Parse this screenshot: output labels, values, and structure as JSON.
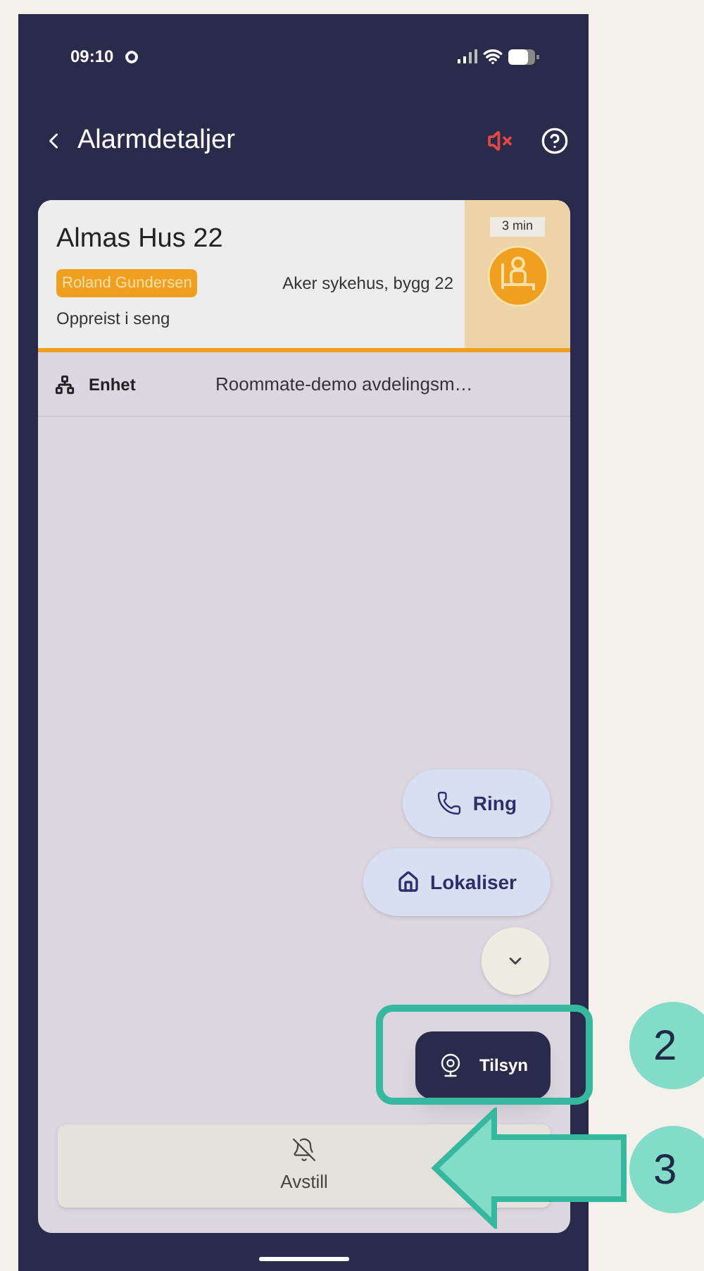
{
  "status_bar": {
    "time": "09:10"
  },
  "header": {
    "title": "Alarmdetaljer"
  },
  "alarm": {
    "room": "Almas Hus 22",
    "resident": "Roland Gundersen",
    "location": "Aker sykehus, bygg 22",
    "event": "Oppreist i seng",
    "elapsed": "3 min"
  },
  "details": [
    {
      "label": "Enhet",
      "value": "Roommate-demo avdelingsm…"
    }
  ],
  "actions": [
    {
      "kind": "call",
      "label": "Ring"
    },
    {
      "kind": "locate",
      "label": "Lokaliser"
    },
    {
      "kind": "collapse"
    },
    {
      "kind": "supervise",
      "label": "Tilsyn"
    }
  ],
  "reset_button": {
    "label": "Avstill"
  },
  "callouts": [
    "2",
    "3"
  ]
}
